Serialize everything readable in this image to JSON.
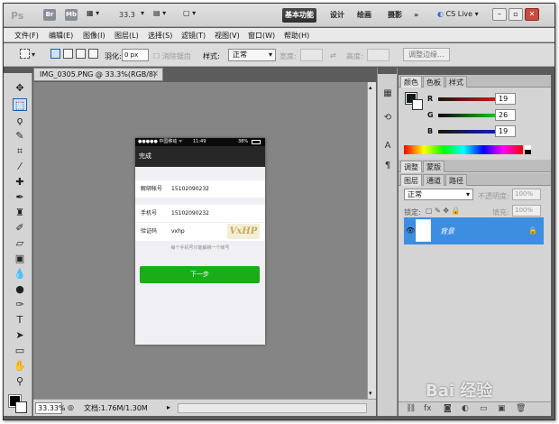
{
  "app": {
    "logo": "Ps",
    "bridge_labels": [
      "Br",
      "Mb"
    ],
    "zoom_level": "33.3",
    "workspaces": [
      "基本功能",
      "设计",
      "绘画",
      "摄影"
    ],
    "more": "»",
    "cs_live": "CS Live ▾",
    "window_buttons": [
      "–",
      "▫",
      "✕"
    ]
  },
  "menu": [
    "文件(F)",
    "编辑(E)",
    "图像(I)",
    "图层(L)",
    "选择(S)",
    "滤镜(T)",
    "视图(V)",
    "窗口(W)",
    "帮助(H)"
  ],
  "options": {
    "feather_label": "羽化:",
    "feather_value": "0 px",
    "antialias": "消除锯齿",
    "style_label": "样式:",
    "style_value": "正常",
    "width_label": "宽度:",
    "height_label": "高度:",
    "refine_button": "调整边缘..."
  },
  "document": {
    "tab_title": "IMG_0305.PNG @ 33.3%(RGB/8)",
    "close": "×",
    "zoom": "33.33%",
    "info": "文档:1.76M/1.30M"
  },
  "phone": {
    "status_left": "●●●●● 中国移动 ᯤ",
    "status_time": "11:49",
    "status_right": "38%",
    "nav_title": "完成",
    "rows": [
      {
        "label": "解绑帐号",
        "value": "15102090232"
      },
      {
        "label": "手机号",
        "value": "15102090232"
      },
      {
        "label": "验证码",
        "value": "vxhp"
      }
    ],
    "captcha": "VxHP",
    "hint": "每个手机号只能解绑一个帐号",
    "button": "下一步"
  },
  "color_panel": {
    "tabs": [
      "颜色",
      "色板",
      "样式"
    ],
    "channels": [
      {
        "name": "R",
        "value": "19"
      },
      {
        "name": "G",
        "value": "26"
      },
      {
        "name": "B",
        "value": "19"
      }
    ]
  },
  "adjust_tabs": [
    "调整",
    "蒙版"
  ],
  "layers_panel": {
    "tabs": [
      "图层",
      "通道",
      "路径"
    ],
    "blend_mode": "正常",
    "opacity_label": "不透明度:",
    "opacity_value": "100%",
    "lock_label": "锁定:",
    "fill_label": "填充:",
    "fill_value": "100%",
    "layer_name": "背景",
    "lock_icon": "🔒"
  },
  "watermark": "Bai 经验",
  "colors": {
    "accent_green": "#1aad19",
    "layer_selected": "#3d8ee0",
    "canvas_bg": "#858585"
  }
}
